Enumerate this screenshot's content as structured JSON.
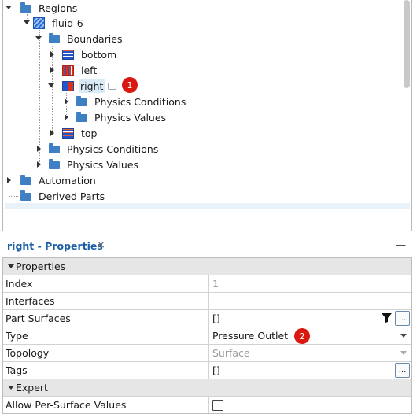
{
  "tree": {
    "items": [
      {
        "label": "Regions"
      },
      {
        "label": "fluid-6"
      },
      {
        "label": "Boundaries"
      },
      {
        "label": "bottom"
      },
      {
        "label": "left"
      },
      {
        "label": "right"
      },
      {
        "label": "Physics Conditions"
      },
      {
        "label": "Physics Values"
      },
      {
        "label": "top"
      },
      {
        "label": "Physics Conditions"
      },
      {
        "label": "Physics Values"
      },
      {
        "label": "Automation"
      },
      {
        "label": "Derived Parts"
      }
    ],
    "badge1": "1"
  },
  "properties": {
    "title": "right - Properties",
    "close": "×",
    "minimize": "—",
    "category": "Properties",
    "rows": [
      {
        "name": "Index",
        "value": "1"
      },
      {
        "name": "Interfaces",
        "value": ""
      },
      {
        "name": "Part Surfaces",
        "value": "[]"
      },
      {
        "name": "Type",
        "value": "Pressure Outlet"
      },
      {
        "name": "Topology",
        "value": "Surface"
      },
      {
        "name": "Tags",
        "value": "[]"
      }
    ],
    "expert_category": "Expert",
    "expert_rows": [
      {
        "name": "Allow Per-Surface Values",
        "checked": false
      }
    ],
    "ellipsis": "...",
    "badge2": "2"
  },
  "colors": {
    "accent": "#1a5ea6",
    "badge": "#d9180f",
    "selection": "#d9ebf7"
  }
}
